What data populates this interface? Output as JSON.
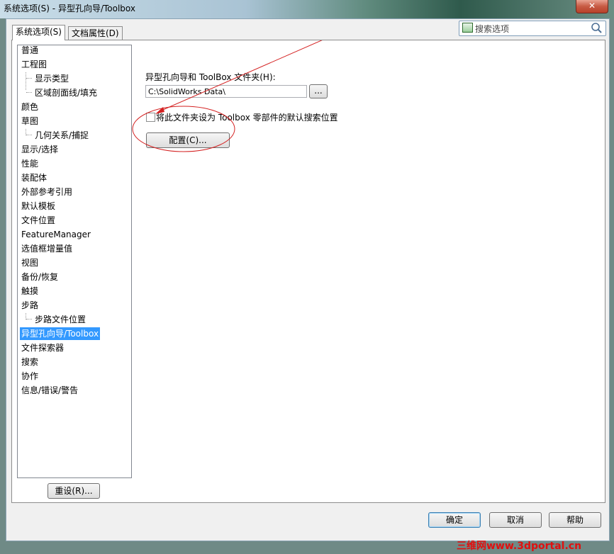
{
  "window": {
    "title": "系统选项(S) - 异型孔向导/Toolbox",
    "close_symbol": "✕"
  },
  "tabs": [
    {
      "label": "系统选项(S)",
      "active": true
    },
    {
      "label": "文档属性(D)",
      "active": false
    }
  ],
  "search": {
    "placeholder": "搜索选项",
    "icon": "magnifier-icon"
  },
  "tree": {
    "items": [
      {
        "label": "普通"
      },
      {
        "label": "工程图"
      },
      {
        "label": "显示类型"
      },
      {
        "label": "区域剖面线/填充"
      },
      {
        "label": "颜色"
      },
      {
        "label": "草图"
      },
      {
        "label": "几何关系/捕捉"
      },
      {
        "label": "显示/选择"
      },
      {
        "label": "性能"
      },
      {
        "label": "装配体"
      },
      {
        "label": "外部参考引用"
      },
      {
        "label": "默认模板"
      },
      {
        "label": "文件位置"
      },
      {
        "label": "FeatureManager"
      },
      {
        "label": "选值框增量值"
      },
      {
        "label": "视图"
      },
      {
        "label": "备份/恢复"
      },
      {
        "label": "触摸"
      },
      {
        "label": "步路"
      },
      {
        "label": "步路文件位置"
      },
      {
        "label": "异型孔向导/Toolbox"
      },
      {
        "label": "文件探索器"
      },
      {
        "label": "搜索"
      },
      {
        "label": "协作"
      },
      {
        "label": "信息/错误/警告"
      }
    ],
    "selected": "异型孔向导/Toolbox"
  },
  "main": {
    "folder_label": "异型孔向导和 ToolBox 文件夹(H):",
    "folder_value": "C:\\SolidWorks Data\\",
    "browse_label": "...",
    "checkbox_label": "将此文件夹设为 Toolbox 零部件的默认搜索位置",
    "checkbox_checked": false,
    "configure_label": "配置(C)..."
  },
  "footer": {
    "reset_label": "重设(R)...",
    "ok_label": "确定",
    "cancel_label": "取消",
    "help_label": "帮助"
  },
  "watermark": "三维网www.3dportal.cn",
  "colors": {
    "selection": "#3399ff",
    "annotation": "#d42020",
    "watermark": "#e01010"
  }
}
